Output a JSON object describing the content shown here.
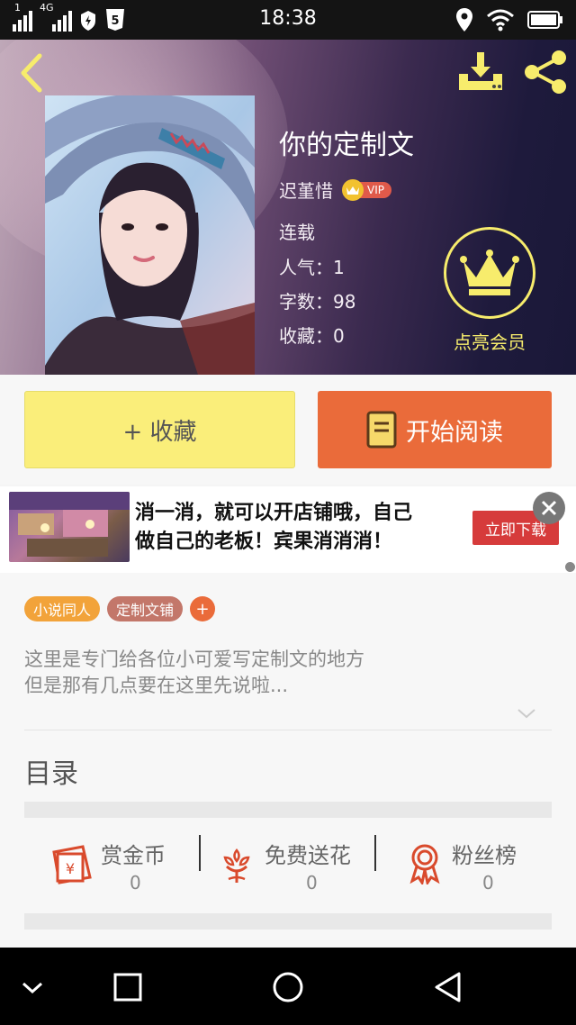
{
  "status_bar": {
    "time": "18:38",
    "sim1": "1",
    "sim2": "4G"
  },
  "book": {
    "title": "你的定制文",
    "author": "迟堇惜",
    "vip_label": "VIP",
    "status": "连载",
    "popularity": "人气：1",
    "word_count": "字数：98",
    "favorites": "收藏：0",
    "vip_badge_label": "点亮会员"
  },
  "actions": {
    "collect_label": "+ 收藏",
    "read_label": "开始阅读"
  },
  "ad": {
    "line1": "消一消，就可以开店铺哦，自己",
    "line2": "做自己的老板！宾果消消消！",
    "cta": "立即下载"
  },
  "tags": [
    {
      "label": "小说同人",
      "color": "#f2a33a"
    },
    {
      "label": "定制文铺",
      "color": "#c3776a"
    }
  ],
  "tag_add": "+",
  "description": {
    "line1": "这里是专门给各位小可爱写定制文的地方",
    "line2": "但是那有几点要在这里先说啦..."
  },
  "toc": {
    "title": "目录"
  },
  "stats": [
    {
      "label": "赏金币",
      "value": "0",
      "icon": "coin-envelope-icon"
    },
    {
      "label": "免费送花",
      "value": "0",
      "icon": "flower-icon"
    },
    {
      "label": "粉丝榜",
      "value": "0",
      "icon": "medal-icon"
    }
  ],
  "colors": {
    "accent_orange": "#ea6b3a",
    "accent_yellow": "#faee7a",
    "gold": "#f7ec6c",
    "icon_red": "#d94a2c"
  }
}
